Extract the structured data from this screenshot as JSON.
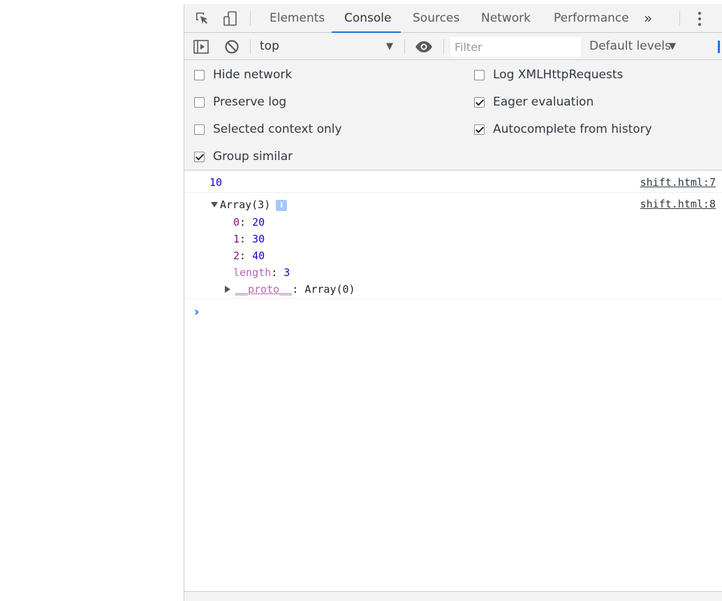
{
  "tabs": [
    {
      "label": "Elements"
    },
    {
      "label": "Console"
    },
    {
      "label": "Sources"
    },
    {
      "label": "Network"
    },
    {
      "label": "Performance"
    }
  ],
  "tab_overflow": "»",
  "toolbar": {
    "context": "top",
    "filter_placeholder": "Filter",
    "levels": "Default levels"
  },
  "settings": {
    "left": [
      {
        "label": "Hide network",
        "checked": false
      },
      {
        "label": "Preserve log",
        "checked": false
      },
      {
        "label": "Selected context only",
        "checked": false
      },
      {
        "label": "Group similar",
        "checked": true
      }
    ],
    "right": [
      {
        "label": "Log XMLHttpRequests",
        "checked": false
      },
      {
        "label": "Eager evaluation",
        "checked": true
      },
      {
        "label": "Autocomplete from history",
        "checked": true
      }
    ]
  },
  "messages": [
    {
      "value": "10",
      "source": "shift.html:7"
    },
    {
      "summary": "Array(3)",
      "info": "i",
      "source": "shift.html:8",
      "entries": [
        {
          "key": "0",
          "value": "20"
        },
        {
          "key": "1",
          "value": "30"
        },
        {
          "key": "2",
          "value": "40"
        },
        {
          "key": "length",
          "value": "3"
        }
      ],
      "proto_key": "__proto__",
      "proto_value": "Array(0)"
    }
  ],
  "prompt": "›",
  "colors": {
    "accent": "#1a73e8",
    "number": "#1c00cf",
    "key": "#881280",
    "panel": "#f3f3f3"
  }
}
